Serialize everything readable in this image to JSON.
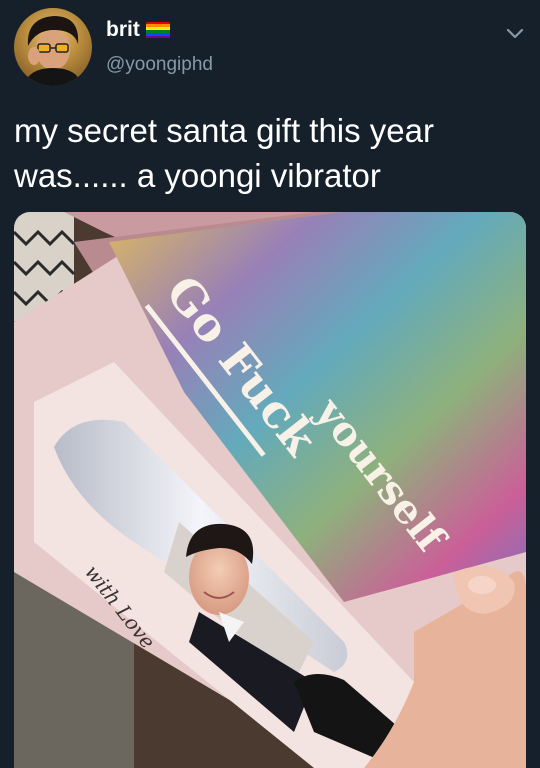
{
  "tweet": {
    "author": {
      "display_name": "brit",
      "handle": "@yoongiphd",
      "avatar_icon": "user-avatar-photo",
      "flag_icon": "rainbow-flag-icon",
      "flag_colors": [
        "#e40303",
        "#ff8c00",
        "#ffed00",
        "#008026",
        "#004dff",
        "#750787"
      ]
    },
    "menu_icon": "chevron-down-icon",
    "text_lines": [
      "my secret santa gift this year",
      "was...... a yoongi vibrator"
    ],
    "photo": {
      "box_text_main": "Go Fuck",
      "box_text_second": "yourself",
      "box_side_text": "with Love"
    }
  },
  "colors": {
    "background": "#15202b",
    "text_primary": "#ffffff",
    "text_secondary": "#8899a6"
  }
}
